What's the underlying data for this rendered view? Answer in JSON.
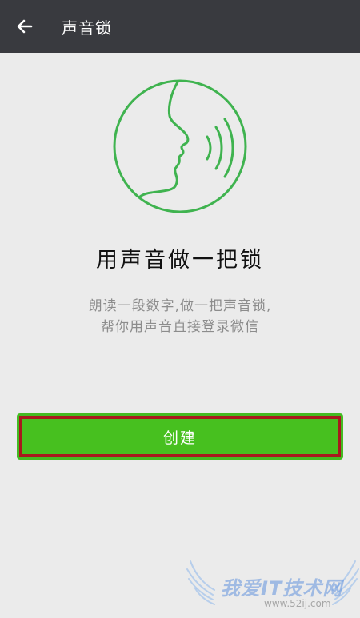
{
  "header": {
    "title": "声音锁",
    "back_icon": "arrow-left-icon"
  },
  "hero": {
    "icon": "voice-face-icon",
    "accent_color": "#3fb34f"
  },
  "main": {
    "headline": "用声音做一把锁",
    "description_line1": "朗读一段数字,做一把声音锁,",
    "description_line2": "帮你用声音直接登录微信"
  },
  "actions": {
    "create_label": "创建",
    "button_color": "#47c01f",
    "highlight_border_color": "#a8191d"
  },
  "watermark": {
    "text": "我爱IT技术网",
    "url": "www.52ij.com"
  }
}
